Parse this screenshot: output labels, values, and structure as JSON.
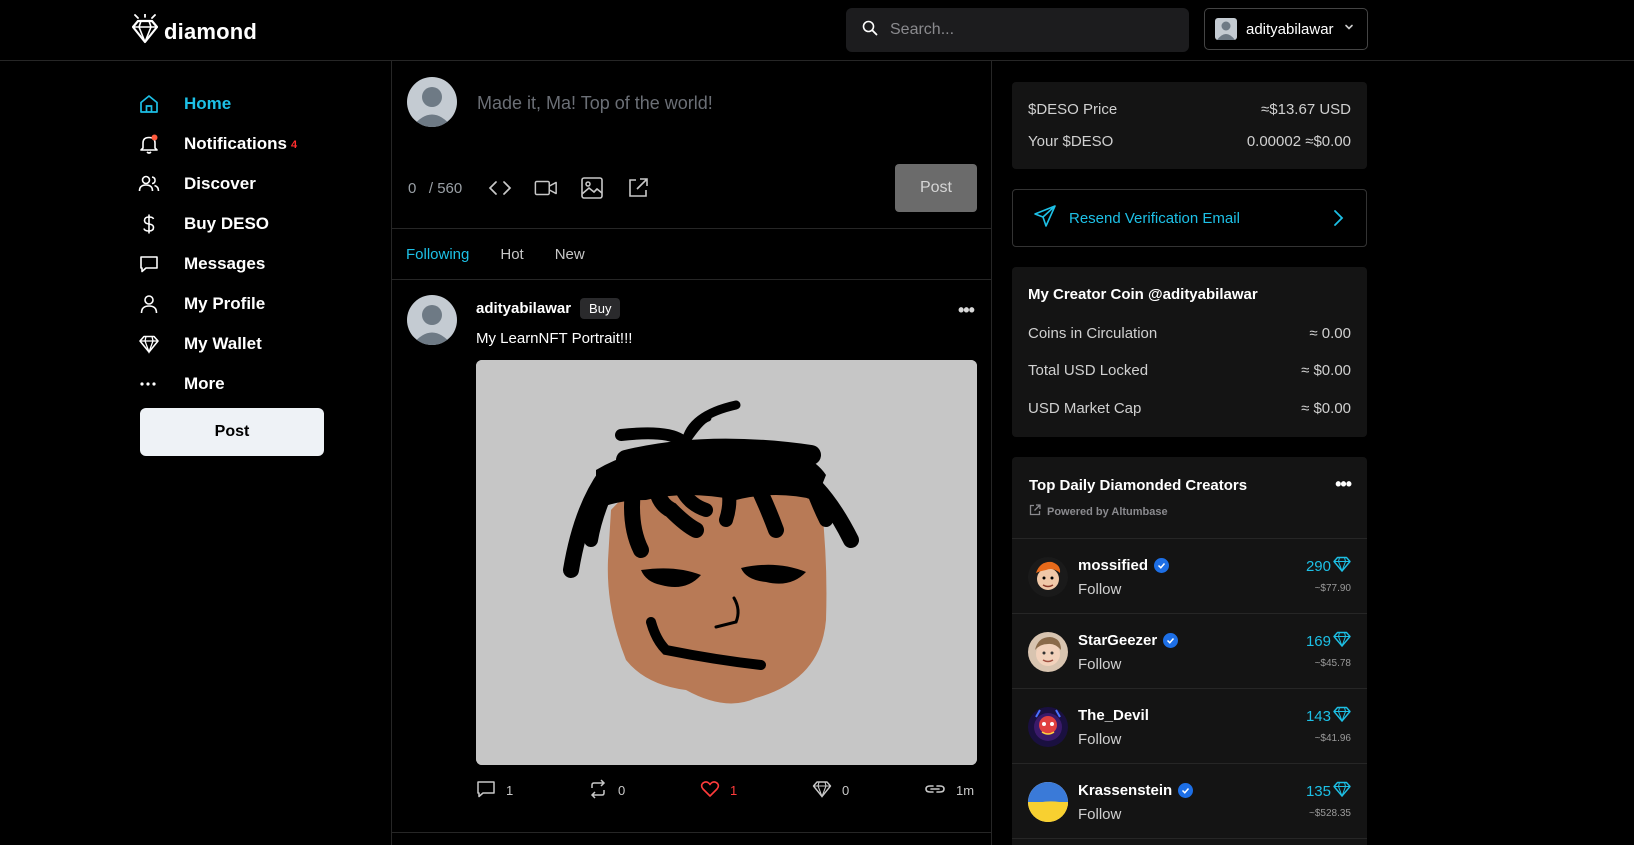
{
  "header": {
    "logo_text": "diamond",
    "search_placeholder": "Search...",
    "account_name": "adityabilawar"
  },
  "sidebar": {
    "items": [
      {
        "label": "Home",
        "icon": "home-icon",
        "active": true
      },
      {
        "label": "Notifications",
        "icon": "bell-icon",
        "badge": "4"
      },
      {
        "label": "Discover",
        "icon": "users-icon"
      },
      {
        "label": "Buy DESO",
        "icon": "dollar-icon"
      },
      {
        "label": "Messages",
        "icon": "message-icon"
      },
      {
        "label": "My Profile",
        "icon": "user-icon"
      },
      {
        "label": "My Wallet",
        "icon": "diamond-icon"
      },
      {
        "label": "More",
        "icon": "more-icon"
      }
    ],
    "post_button": "Post"
  },
  "composer": {
    "placeholder": "Made it, Ma! Top of the world!",
    "char_count": "0",
    "char_limit": "/ 560",
    "post_button": "Post"
  },
  "feed": {
    "tabs": [
      {
        "label": "Following",
        "active": true
      },
      {
        "label": "Hot"
      },
      {
        "label": "New"
      }
    ],
    "post": {
      "username": "adityabilawar",
      "buy_label": "Buy",
      "text": "My LearnNFT Portrait!!!",
      "comments": "1",
      "reposts": "0",
      "likes": "1",
      "diamonds": "0",
      "age": "1m"
    }
  },
  "right": {
    "price": {
      "deso_price_label": "$DESO Price",
      "deso_price_value": "≈$13.67 USD",
      "your_deso_label": "Your $DESO",
      "your_deso_value": "0.00002 ≈$0.00"
    },
    "verify": {
      "label": "Resend Verification Email"
    },
    "creator_coin": {
      "title": "My Creator Coin @adityabilawar",
      "rows": [
        {
          "label": "Coins in Circulation",
          "value": "≈ 0.00"
        },
        {
          "label": "Total USD Locked",
          "value": "≈ $0.00"
        },
        {
          "label": "USD Market Cap",
          "value": "≈ $0.00"
        }
      ]
    },
    "top_creators": {
      "title": "Top Daily Diamonded Creators",
      "powered_by": "Powered by Altumbase",
      "creators": [
        {
          "name": "mossified",
          "follow": "Follow",
          "diamonds": "290",
          "usd": "~$77.90"
        },
        {
          "name": "StarGeezer",
          "follow": "Follow",
          "diamonds": "169",
          "usd": "~$45.78"
        },
        {
          "name": "The_Devil",
          "follow": "Follow",
          "diamonds": "143",
          "usd": "~$41.96"
        },
        {
          "name": "Krassenstein",
          "follow": "Follow",
          "diamonds": "135",
          "usd": "~$528.35"
        }
      ]
    }
  },
  "colors": {
    "accent": "#1dc0e6",
    "like": "#ff3b3b",
    "background": "#000000",
    "card": "#141414"
  }
}
